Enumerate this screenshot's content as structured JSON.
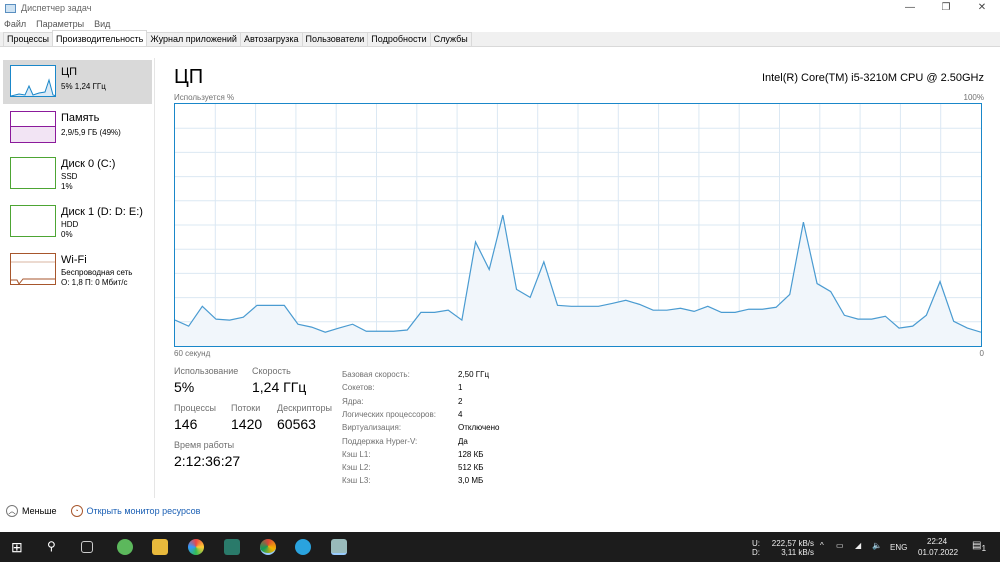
{
  "window": {
    "title": "Диспетчер задач",
    "controls": [
      "—",
      "❐",
      "✕"
    ]
  },
  "menu": [
    "Файл",
    "Параметры",
    "Вид"
  ],
  "tabs": [
    "Процессы",
    "Производительность",
    "Журнал приложений",
    "Автозагрузка",
    "Пользователи",
    "Подробности",
    "Службы"
  ],
  "sidebar": [
    {
      "name": "ЦП",
      "sub1": "5% 1,24 ГГц",
      "sub2": "",
      "color": "#1a87c9"
    },
    {
      "name": "Память",
      "sub1": "2,9/5,9 ГБ (49%)",
      "sub2": "",
      "color": "#8b1a9b"
    },
    {
      "name": "Диск 0 (C:)",
      "sub1": "SSD",
      "sub2": "1%",
      "color": "#4da534"
    },
    {
      "name": "Диск 1 (D: D: E:)",
      "sub1": "HDD",
      "sub2": "0%",
      "color": "#4da534"
    },
    {
      "name": "Wi-Fi",
      "sub1": "Беспроводная сеть",
      "sub2": "О: 1,8 П: 0 Мбит/с",
      "color": "#a7562c"
    }
  ],
  "main": {
    "title": "ЦП",
    "model": "Intel(R) Core(TM) i5-3210M CPU @ 2.50GHz",
    "y_label": "Используется %",
    "y_max": "100%",
    "x_left": "60 секунд",
    "x_right": "0"
  },
  "chart_data": {
    "type": "area",
    "title": "ЦП",
    "ylabel": "Используется %",
    "xlabel": "60 секунд",
    "ylim": [
      0,
      100
    ],
    "xlim": [
      60,
      0
    ],
    "values": [
      10.7,
      8.2,
      16.4,
      11.1,
      10.7,
      11.9,
      16.8,
      16.8,
      16.8,
      9.0,
      7.8,
      5.7,
      7.4,
      9.0,
      6.1,
      6.1,
      6.1,
      6.6,
      13.9,
      13.9,
      14.8,
      10.7,
      43,
      31.6,
      54.1,
      23.4,
      20.1,
      34.8,
      16.8,
      16.4,
      16.4,
      16.4,
      17.6,
      18.9,
      17.2,
      14.8,
      14.8,
      15.6,
      14.3,
      16.4,
      13.9,
      13.9,
      15.2,
      15.2,
      16,
      21.3,
      51.2,
      25.8,
      22.5,
      12.7,
      11.1,
      11.1,
      12.3,
      7.4,
      8.2,
      12.7,
      26.6,
      10.2,
      7.4,
      5.7
    ]
  },
  "stats": {
    "usage_label": "Использование",
    "usage": "5%",
    "speed_label": "Скорость",
    "speed": "1,24 ГГц",
    "proc_label": "Процессы",
    "proc": "146",
    "threads_label": "Потоки",
    "threads": "1420",
    "handles_label": "Дескрипторы",
    "handles": "60563",
    "uptime_label": "Время работы",
    "uptime": "2:12:36:27"
  },
  "specs": [
    [
      "Базовая скорость:",
      "2,50 ГГц"
    ],
    [
      "Сокетов:",
      "1"
    ],
    [
      "Ядра:",
      "2"
    ],
    [
      "Логических процессоров:",
      "4"
    ],
    [
      "Виртуализация:",
      "Отключено"
    ],
    [
      "Поддержка Hyper-V:",
      "Да"
    ],
    [
      "Кэш L1:",
      "128 КБ"
    ],
    [
      "Кэш L2:",
      "512 КБ"
    ],
    [
      "Кэш L3:",
      "3,0 МБ"
    ]
  ],
  "footer": {
    "less": "Меньше",
    "monitor": "Открыть монитор ресурсов"
  },
  "taskbar": {
    "up_label": "U:",
    "up": "222,57 kB/s",
    "down_label": "D:",
    "down": "3,11 kB/s",
    "lang": "ENG",
    "time": "22:24",
    "date": "01.07.2022",
    "notif": "1"
  }
}
